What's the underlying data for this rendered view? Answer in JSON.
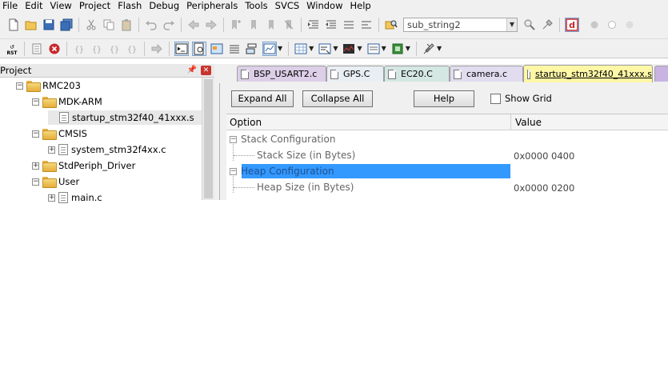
{
  "menu": [
    "File",
    "Edit",
    "View",
    "Project",
    "Flash",
    "Debug",
    "Peripherals",
    "Tools",
    "SVCS",
    "Window",
    "Help"
  ],
  "toolbar": {
    "search_combo": "sub_string2",
    "icons1": [
      "new-file",
      "open-file",
      "save",
      "save-all",
      "cut",
      "copy",
      "paste",
      "undo",
      "redo",
      "nav-back",
      "nav-forward",
      "bookmark-set",
      "bookmark-prev",
      "bookmark-next",
      "bookmark-clear",
      "indent",
      "unindent",
      "comment",
      "uncomment",
      "find-in-files",
      "debug-session"
    ],
    "icons2": [
      "reset-rst",
      "stop-red",
      "run-text",
      "step-in",
      "step-over",
      "step-out",
      "run-to-cursor",
      "command-window",
      "disassembly",
      "symbols",
      "registers",
      "call-stack",
      "watch",
      "memory",
      "serial",
      "analysis",
      "trace",
      "system-viewer",
      "toolbox"
    ]
  },
  "project": {
    "title": "Project",
    "tree": [
      {
        "label": "RMC203",
        "level": 0,
        "type": "target",
        "expander": "−"
      },
      {
        "label": "MDK-ARM",
        "level": 1,
        "type": "folder",
        "expander": "−"
      },
      {
        "label": "startup_stm32f40_41xxx.s",
        "level": 2,
        "type": "file",
        "expander": "",
        "selected": true
      },
      {
        "label": "CMSIS",
        "level": 1,
        "type": "folder",
        "expander": "−"
      },
      {
        "label": "system_stm32f4xx.c",
        "level": 2,
        "type": "file",
        "expander": "+"
      },
      {
        "label": "StdPeriph_Driver",
        "level": 1,
        "type": "folder",
        "expander": "+"
      },
      {
        "label": "User",
        "level": 1,
        "type": "folder",
        "expander": "−"
      },
      {
        "label": "main.c",
        "level": 2,
        "type": "file",
        "expander": "+"
      }
    ]
  },
  "tabs": [
    {
      "label": "BSP_USART2.c",
      "color": "#dccfe7",
      "active": false
    },
    {
      "label": "GPS.C",
      "color": "#e9eef5",
      "active": false
    },
    {
      "label": "EC20.C",
      "color": "#d4e7e3",
      "active": false
    },
    {
      "label": "camera.c",
      "color": "#e2dcef",
      "active": false
    },
    {
      "label": "startup_stm32f40_41xxx.s",
      "color": "#fdf7a6",
      "active": true
    }
  ],
  "wizard": {
    "expand_all": "Expand All",
    "collapse_all": "Collapse All",
    "help": "Help",
    "show_grid": "Show Grid",
    "col_option": "Option",
    "col_value": "Value",
    "rows": [
      {
        "option": "Stack Configuration",
        "value": "",
        "level": 0,
        "expander": "−",
        "highlight": false
      },
      {
        "option": "Stack Size (in Bytes)",
        "value": "0x0000 0400",
        "level": 1,
        "expander": "",
        "highlight": false
      },
      {
        "option": "Heap Configuration",
        "value": "",
        "level": 0,
        "expander": "−",
        "highlight": true
      },
      {
        "option": "Heap Size (in Bytes)",
        "value": "0x0000 0200",
        "level": 1,
        "expander": "",
        "highlight": false
      }
    ]
  }
}
